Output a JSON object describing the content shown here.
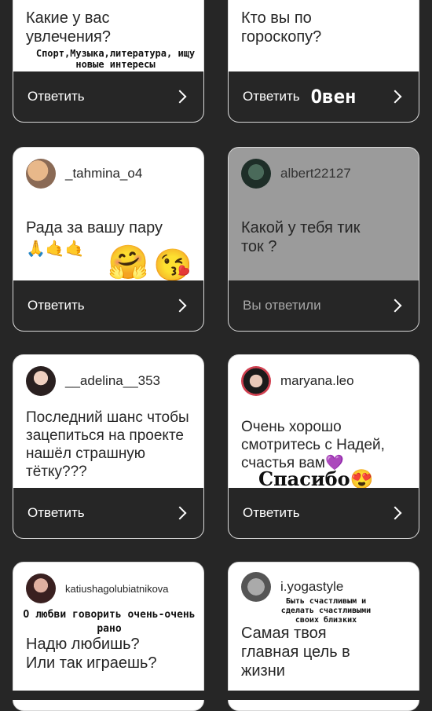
{
  "cards": [
    {
      "question": "Какие у вас увлечения?",
      "answer_overlay": "Спорт,Музыка,литература, ищу новые интересы",
      "action": "Ответить"
    },
    {
      "question": "Кто вы по гороскопу?",
      "answer_overlay": "Овен",
      "action": "Ответить"
    },
    {
      "username": "_tahmina_o4",
      "question": "Рада за вашу пару",
      "action": "Ответить"
    },
    {
      "username": "albert22127",
      "question": "Какой у тебя тик ток ?",
      "action": "Вы ответили"
    },
    {
      "username": "__adelina__353",
      "question": "Последний шанс чтобы зацепиться на проекте нашёл страшную тётку???",
      "action": "Ответить"
    },
    {
      "username": "maryana.leo",
      "question": "Очень хорошо смотритесь с Надей, счастья вам",
      "answer_overlay": "Спасибо",
      "action": "Ответить"
    },
    {
      "username": "katiushagolubiatnikova",
      "question": "Надю любишь? Или так играешь?",
      "answer_overlay": "О любви говорить очень-очень рано"
    },
    {
      "username": "i.yogastyle",
      "question": "Самая твоя главная цель в жизни",
      "answer_overlay": "Быть счастливым и сделать счастливыми своих близких"
    }
  ],
  "colors": {
    "background": "#262626",
    "card_white": "#ffffff",
    "card_answered": "#9b9b9b",
    "card_border": "#d8d8d8"
  }
}
